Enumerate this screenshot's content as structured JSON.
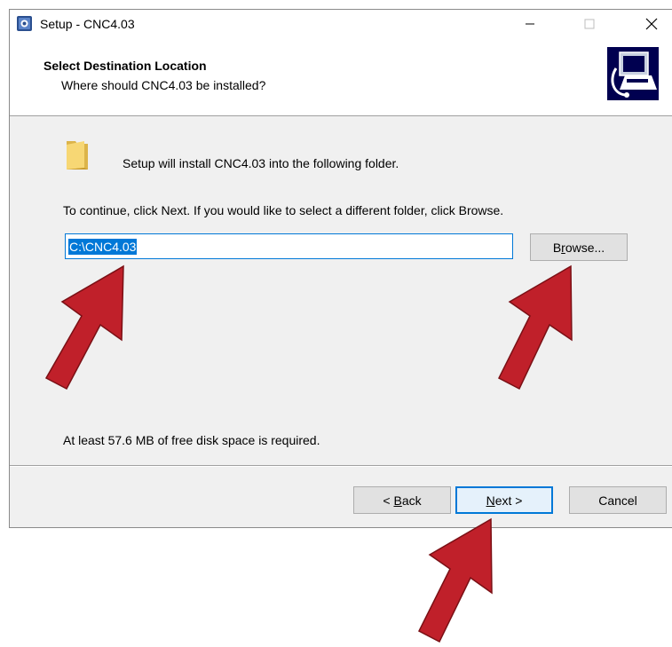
{
  "window": {
    "title": "Setup - CNC4.03",
    "minimize_glyph": "—",
    "maximize_glyph": "☐",
    "close_glyph": "✕"
  },
  "header": {
    "title": "Select Destination Location",
    "subtitle": "Where should CNC4.03 be installed?"
  },
  "body": {
    "install_text": "Setup will install CNC4.03 into the following folder.",
    "continue_text": "To continue, click Next. If you would like to select a different folder, click Browse.",
    "path_value": "C:\\CNC4.03",
    "space_text": "At least 57.6 MB of free disk space is required."
  },
  "buttons": {
    "browse_pre": "B",
    "browse_ul": "r",
    "browse_post": "owse...",
    "back_pre": "< ",
    "back_ul": "B",
    "back_post": "ack",
    "next_ul": "N",
    "next_post": "ext >",
    "cancel": "Cancel"
  },
  "colors": {
    "accent": "#0078d7",
    "arrow": "#c0202a",
    "window_bg": "#f0f0f0"
  },
  "icons": [
    "setup-app-icon",
    "folder-icon",
    "wizard-computer-icon",
    "minimize-icon",
    "maximize-icon",
    "close-icon"
  ]
}
